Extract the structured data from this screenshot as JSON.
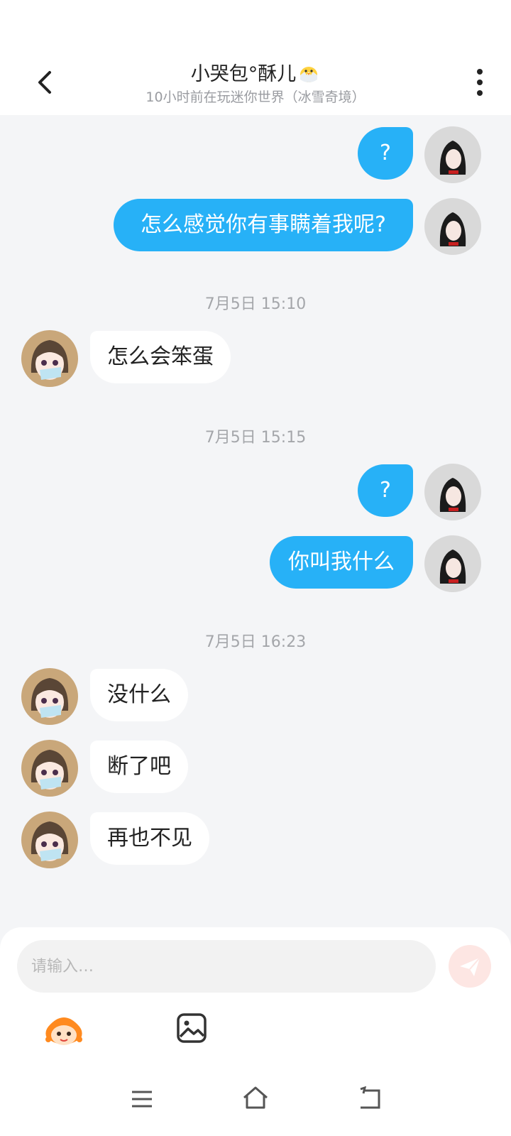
{
  "header": {
    "title": "小哭包°酥儿",
    "subtitle": "10小时前在玩迷你世界（冰雪奇境）"
  },
  "messages": [
    {
      "from": "me",
      "text": "?"
    },
    {
      "from": "me",
      "text": "怎么感觉你有事瞒着我呢?"
    },
    {
      "time": "7月5日 15:10"
    },
    {
      "from": "them",
      "text": "怎么会笨蛋"
    },
    {
      "time": "7月5日 15:15"
    },
    {
      "from": "me",
      "text": "?"
    },
    {
      "from": "me",
      "text": "你叫我什么"
    },
    {
      "time": "7月5日 16:23"
    },
    {
      "from": "them",
      "text": "没什么"
    },
    {
      "from": "them",
      "text": "断了吧"
    },
    {
      "from": "them",
      "text": "再也不见"
    }
  ],
  "input": {
    "placeholder": "请输入…"
  },
  "icons": {
    "back": "chevron-left-icon",
    "more": "more-vertical-icon",
    "chick": "chick-emoji-icon",
    "send": "send-plane-icon",
    "emoji": "mascot-emoji-icon",
    "image": "image-icon",
    "nav_menu": "menu-icon",
    "nav_home": "home-icon",
    "nav_back": "back-icon"
  },
  "colors": {
    "my_bubble": "#27b1f7",
    "their_bubble": "#ffffff",
    "chat_background": "#f4f5f7",
    "send_button": "#fde6e3"
  }
}
